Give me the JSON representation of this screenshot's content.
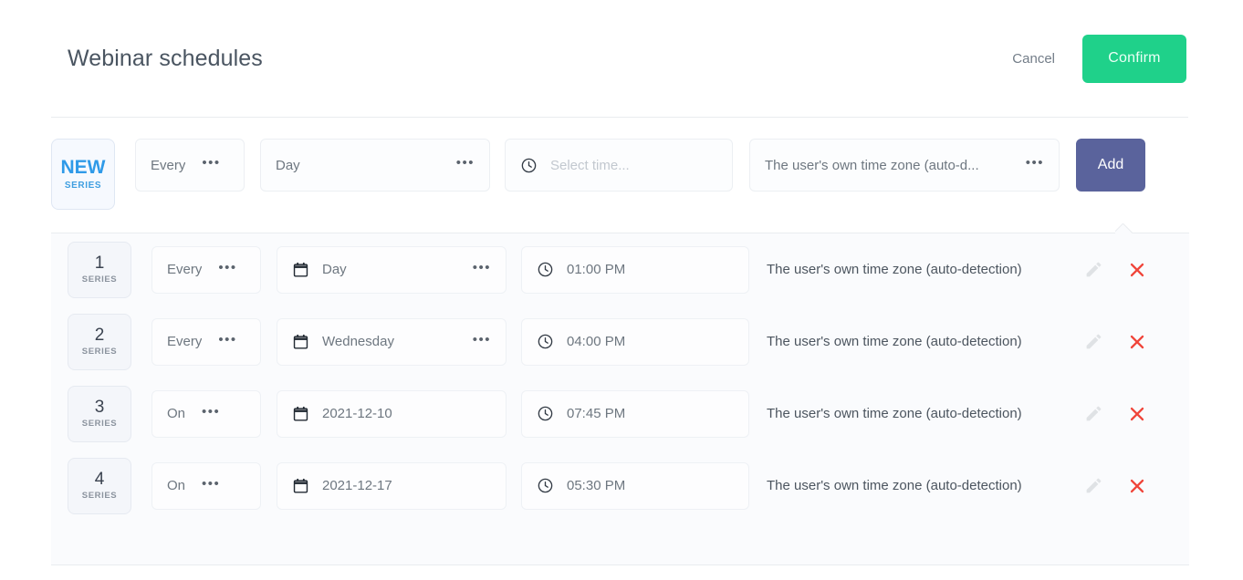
{
  "header": {
    "title": "Webinar schedules",
    "cancel_label": "Cancel",
    "confirm_label": "Confirm"
  },
  "new_series": {
    "badge_num": "NEW",
    "badge_sub": "SERIES",
    "frequency": "Every",
    "unit": "Day",
    "time_placeholder": "Select time...",
    "timezone": "The user's own time zone (auto-d...",
    "add_label": "Add",
    "dots": "•••"
  },
  "schedules": [
    {
      "badge_num": "1",
      "badge_sub": "SERIES",
      "frequency": "Every",
      "unit": "Day",
      "time": "01:00 PM",
      "timezone": "The user's own time zone (auto-detection)",
      "has_unit_dots": true
    },
    {
      "badge_num": "2",
      "badge_sub": "SERIES",
      "frequency": "Every",
      "unit": "Wednesday",
      "time": "04:00 PM",
      "timezone": "The user's own time zone (auto-detection)",
      "has_unit_dots": true
    },
    {
      "badge_num": "3",
      "badge_sub": "SERIES",
      "frequency": "On",
      "unit": "2021-12-10",
      "time": "07:45 PM",
      "timezone": "The user's own time zone (auto-detection)",
      "has_unit_dots": false
    },
    {
      "badge_num": "4",
      "badge_sub": "SERIES",
      "frequency": "On",
      "unit": "2021-12-17",
      "time": "05:30 PM",
      "timezone": "The user's own time zone (auto-detection)",
      "has_unit_dots": false
    }
  ],
  "icons": {
    "calendar": "calendar-icon",
    "clock": "clock-icon",
    "edit": "pencil-icon",
    "delete": "close-x-icon",
    "dots": "•••"
  },
  "colors": {
    "confirm_green": "#1fd18a",
    "add_blue": "#5a639c",
    "badge_new_blue": "#2f9ae8",
    "delete_red": "#f0453a",
    "panel_bg": "#fafbfd"
  }
}
